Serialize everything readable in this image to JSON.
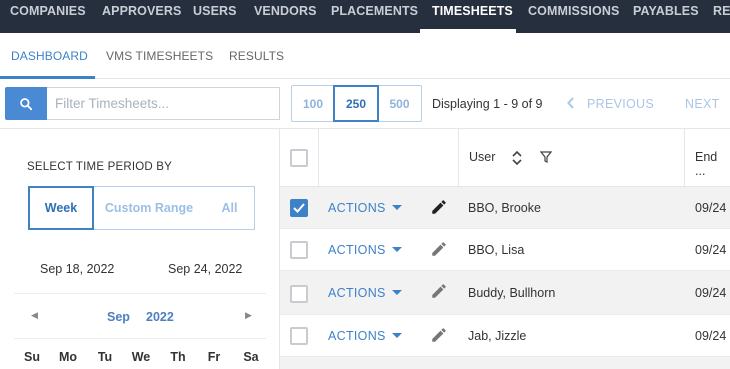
{
  "topnav": {
    "items": [
      "COMPANIES",
      "APPROVERS",
      "USERS",
      "VENDORS",
      "PLACEMENTS",
      "TIMESHEETS",
      "COMMISSIONS",
      "PAYABLES",
      "REC"
    ],
    "active": "TIMESHEETS"
  },
  "subtabs": {
    "items": [
      "DASHBOARD",
      "VMS TIMESHEETS",
      "RESULTS"
    ],
    "active": "DASHBOARD"
  },
  "toolbar": {
    "search_placeholder": "Filter Timesheets...",
    "search_icon": "search-icon",
    "page_sizes": [
      "100",
      "250",
      "500"
    ],
    "page_size_selected": "250",
    "displaying": "Displaying 1 - 9 of 9",
    "previous_label": "PREVIOUS",
    "next_label": "NEXT"
  },
  "period": {
    "label": "SELECT TIME PERIOD BY",
    "options": [
      "Week",
      "Custom Range",
      "All"
    ],
    "selected": "Week",
    "start_date": "Sep 18, 2022",
    "end_date": "Sep 24, 2022"
  },
  "calendar": {
    "month": "Sep",
    "year": "2022",
    "days_of_week": [
      "Su",
      "Mo",
      "Tu",
      "We",
      "Th",
      "Fr",
      "Sa"
    ]
  },
  "grid": {
    "headers": {
      "user": "User",
      "end": "End ..."
    },
    "rows": [
      {
        "actions": "ACTIONS",
        "user": "BBO, Brooke",
        "end": "09/24",
        "checked": true
      },
      {
        "actions": "ACTIONS",
        "user": "BBO, Lisa",
        "end": "09/24",
        "checked": false
      },
      {
        "actions": "ACTIONS",
        "user": "Buddy, Bullhorn",
        "end": "09/24",
        "checked": false
      },
      {
        "actions": "ACTIONS",
        "user": "Jab, Jizzle",
        "end": "09/24",
        "checked": false
      }
    ]
  },
  "colors": {
    "nav_bg": "#262f3e",
    "accent": "#3d82c9",
    "row_alt": "#f2f2f2"
  }
}
